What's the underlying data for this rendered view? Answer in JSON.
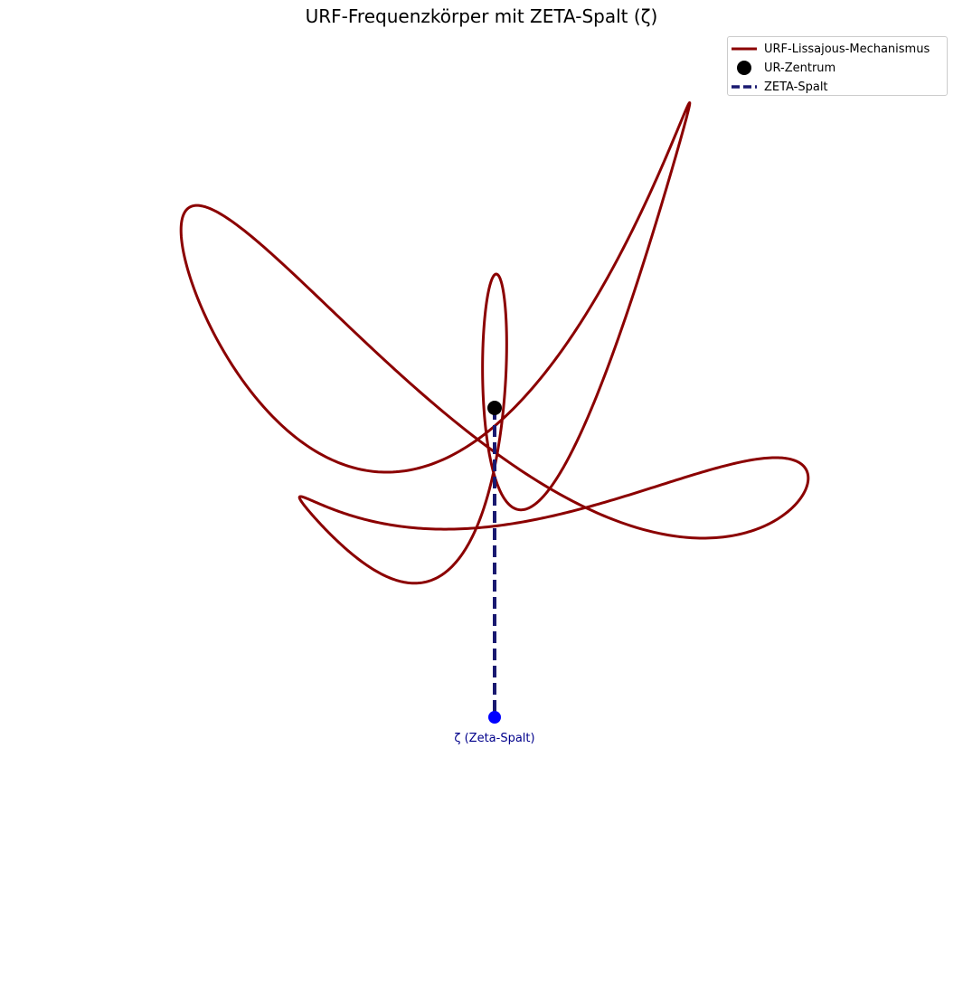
{
  "chart_data": {
    "type": "line",
    "title": "URF-Frequenzkörper mit ZETA-Spalt (ζ)",
    "xlabel": "",
    "ylabel": "",
    "axes_visible": false,
    "grid": false,
    "aspect": "equal",
    "xlim": [
      -1.5,
      1.5
    ],
    "ylim": [
      -1.5,
      1.5
    ],
    "legend_position": "top-right",
    "series": [
      {
        "name": "URF-Lissajous-Mechanismus",
        "kind": "parametric-curve",
        "color": "#8b0000",
        "x": "0.5*sin(2t) + 0.4*cos(3t)",
        "y": "0.4*cos(t) + 0.3*sin(4t+0.5) + 0.3*sin(5t+0.3)",
        "t_range": [
          0,
          6.2832
        ]
      },
      {
        "name": "UR-Zentrum",
        "kind": "point",
        "color": "#000000",
        "x": 0,
        "y": 0
      },
      {
        "name": "ZETA-Spalt",
        "kind": "dashed-segment",
        "color": "#191970",
        "x": [
          0,
          0
        ],
        "y": [
          0,
          -1.0
        ]
      }
    ],
    "annotations": [
      {
        "text": "ζ (Zeta-Spalt)",
        "x": 0,
        "y": -1.0,
        "color": "#00008b",
        "marker_color": "#0000ff"
      }
    ]
  }
}
